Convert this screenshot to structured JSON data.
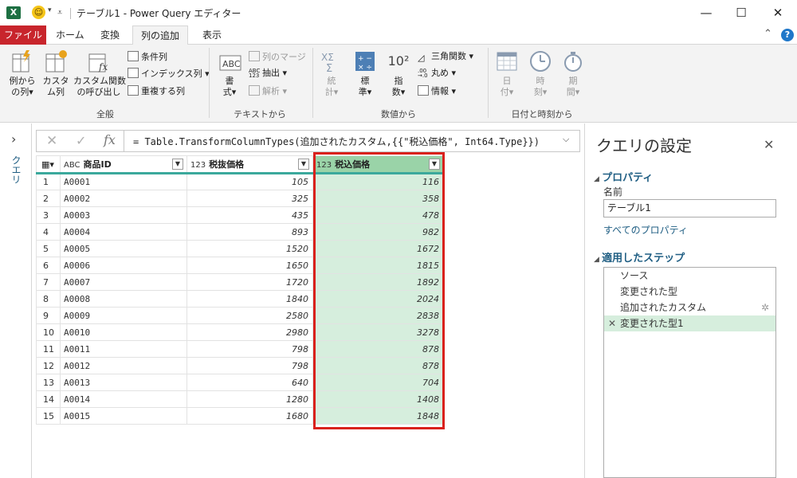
{
  "title_bar": {
    "app_icon": "X",
    "smiley": "☺",
    "title": "テーブル1 - Power Query エディター",
    "minimize": "—",
    "maximize": "☐",
    "close": "✕"
  },
  "tabs": {
    "file": "ファイル",
    "home": "ホーム",
    "transform": "変換",
    "add_column": "列の追加",
    "view": "表示",
    "collapse": "⌃",
    "help": "?"
  },
  "ribbon": {
    "general": {
      "label": "全般",
      "col_from_examples": [
        "例から",
        "の列"
      ],
      "custom_column": [
        "カスタ",
        "ム列"
      ],
      "invoke_custom_function": [
        "カスタム関数",
        "の呼び出し"
      ],
      "conditional_column": "条件列",
      "index_column": "インデックス列",
      "duplicate_column": "重複する列"
    },
    "text": {
      "label": "テキストから",
      "format": [
        "書",
        "式"
      ],
      "merge_columns": "列のマージ",
      "extract": "抽出",
      "parse": "解析"
    },
    "number": {
      "label": "数値から",
      "statistics": [
        "統",
        "計"
      ],
      "standard": [
        "標",
        "準"
      ],
      "scientific": [
        "指",
        "数"
      ],
      "scientific_icon": "10²",
      "trigonometry": "三角関数",
      "rounding": "丸め",
      "information": "情報"
    },
    "datetime": {
      "label": "日付と時刻から",
      "date": [
        "日",
        "付"
      ],
      "time": [
        "時",
        "刻"
      ],
      "duration": [
        "期",
        "間"
      ]
    }
  },
  "left_pane": {
    "expand": "›",
    "label": "クエリ"
  },
  "formula_bar": {
    "cancel": "✕",
    "confirm": "✓",
    "fx": "fx",
    "formula": "= Table.TransformColumnTypes(追加されたカスタム,{{\"税込価格\", Int64.Type}})",
    "expand": "⌄"
  },
  "grid": {
    "columns": [
      {
        "type": "ABC",
        "name": "商品ID"
      },
      {
        "type": "123",
        "name": "税抜価格"
      },
      {
        "type": "123",
        "name": "税込価格"
      }
    ],
    "rows": [
      [
        "1",
        "A0001",
        "105",
        "116"
      ],
      [
        "2",
        "A0002",
        "325",
        "358"
      ],
      [
        "3",
        "A0003",
        "435",
        "478"
      ],
      [
        "4",
        "A0004",
        "893",
        "982"
      ],
      [
        "5",
        "A0005",
        "1520",
        "1672"
      ],
      [
        "6",
        "A0006",
        "1650",
        "1815"
      ],
      [
        "7",
        "A0007",
        "1720",
        "1892"
      ],
      [
        "8",
        "A0008",
        "1840",
        "2024"
      ],
      [
        "9",
        "A0009",
        "2580",
        "2838"
      ],
      [
        "10",
        "A0010",
        "2980",
        "3278"
      ],
      [
        "11",
        "A0011",
        "798",
        "878"
      ],
      [
        "12",
        "A0012",
        "798",
        "878"
      ],
      [
        "13",
        "A0013",
        "640",
        "704"
      ],
      [
        "14",
        "A0014",
        "1280",
        "1408"
      ],
      [
        "15",
        "A0015",
        "1680",
        "1848"
      ]
    ]
  },
  "query_settings": {
    "title": "クエリの設定",
    "close": "✕",
    "properties_header": "プロパティ",
    "name_label": "名前",
    "name_value": "テーブル1",
    "all_properties": "すべてのプロパティ",
    "applied_steps_header": "適用したステップ",
    "steps": [
      "ソース",
      "変更された型",
      "追加されたカスタム",
      "変更された型1"
    ],
    "gear": "✲",
    "delete_step": "✕"
  },
  "colors": {
    "file_tab": "#c8252c",
    "selected_column_header": "#9ad3a8",
    "selected_column_cells": "#d6eedd",
    "highlight_box": "#d9211c",
    "link_blue": "#1f5e83"
  }
}
